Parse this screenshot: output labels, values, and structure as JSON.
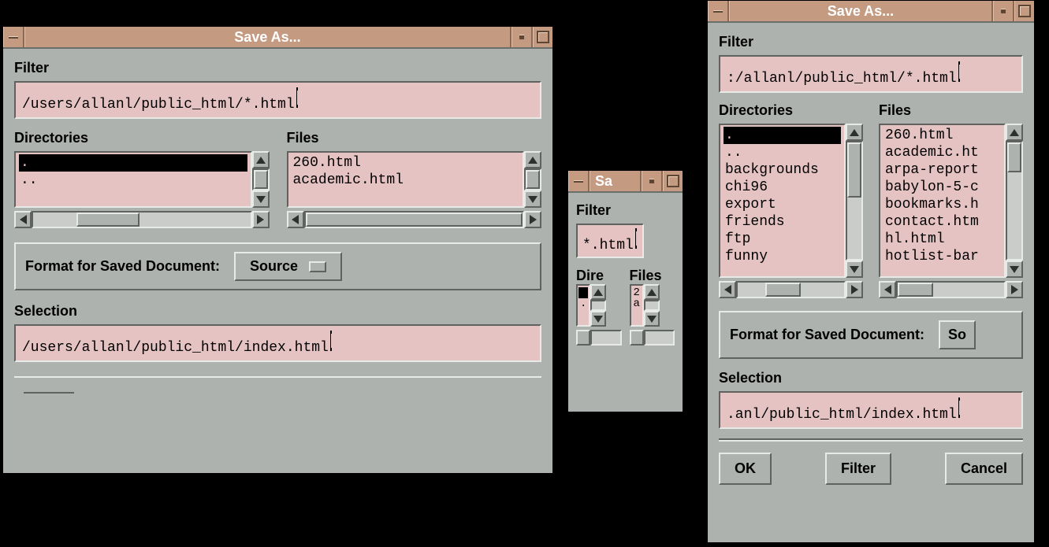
{
  "window1": {
    "title": "Save As...",
    "filter_label": "Filter",
    "filter_value": "/users/allanl/public_html/*.html",
    "directories_label": "Directories",
    "files_label": "Files",
    "directories": [
      ".",
      ".."
    ],
    "dir_selected_index": 0,
    "files": [
      "260.html",
      "academic.html"
    ],
    "format_label": "Format for Saved Document:",
    "format_value": "Source",
    "selection_label": "Selection",
    "selection_value": "/users/allanl/public_html/index.html"
  },
  "window2": {
    "title": "Sa",
    "filter_label": "Filter",
    "filter_value": "*.html",
    "directories_label": "Dire",
    "files_label": "Files"
  },
  "window3": {
    "title": "Save As...",
    "filter_label": "Filter",
    "filter_value": ":/allanl/public_html/*.html",
    "directories_label": "Directories",
    "files_label": "Files",
    "directories": [
      ".",
      "..",
      "backgrounds",
      "chi96",
      "export",
      "friends",
      "ftp",
      "funny"
    ],
    "dir_selected_index": 0,
    "files": [
      "260.html",
      "academic.ht",
      "arpa-report",
      "babylon-5-c",
      "bookmarks.h",
      "contact.htm",
      "hl.html",
      "hotlist-bar"
    ],
    "format_label": "Format for Saved Document:",
    "format_value": "So",
    "selection_label": "Selection",
    "selection_value": ".anl/public_html/index.html",
    "ok_label": "OK",
    "filter_button_label": "Filter",
    "cancel_label": "Cancel"
  }
}
